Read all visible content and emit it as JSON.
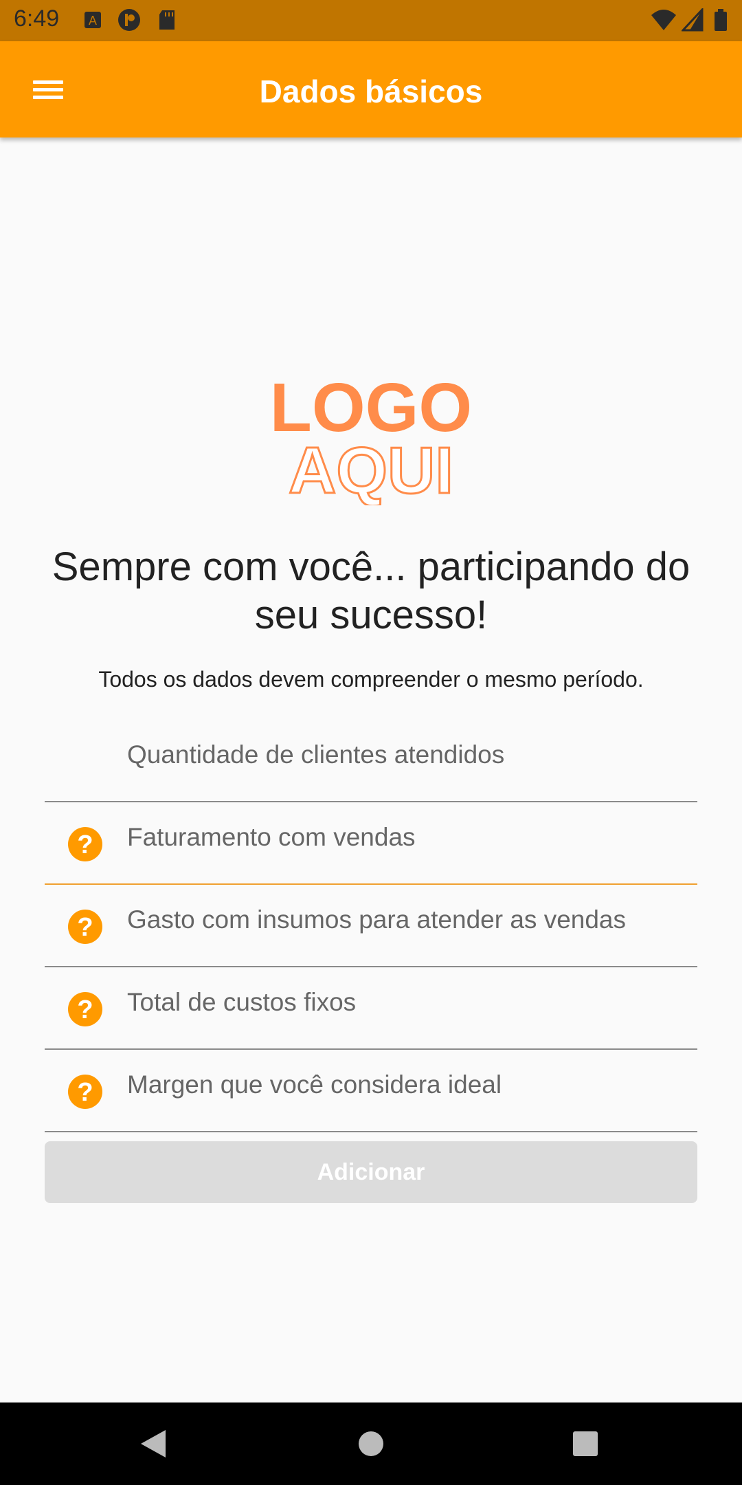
{
  "status_bar": {
    "time": "6:49",
    "icons": [
      "notification-a-icon",
      "notification-p-icon",
      "sd-card-icon",
      "wifi-icon",
      "signal-icon",
      "battery-icon"
    ]
  },
  "app_bar": {
    "title": "Dados básicos",
    "menu_icon": "hamburger-menu-icon"
  },
  "logo": {
    "line1": "LOGO",
    "line2": "AQUI",
    "color": "#ff8c4a"
  },
  "tagline": "Sempre com você... participando do seu sucesso!",
  "subtitle": "Todos os dados devem compreender o mesmo período.",
  "form": {
    "fields": [
      {
        "label": "Quantidade de clientes atendidos",
        "has_help": false
      },
      {
        "label": "Faturamento com vendas",
        "has_help": true,
        "focused": true
      },
      {
        "label": "Gasto com insumos para atender as  vendas",
        "has_help": true
      },
      {
        "label": "Total de custos fixos",
        "has_help": true
      },
      {
        "label": "Margen que você considera ideal",
        "has_help": true
      }
    ],
    "help_glyph": "?",
    "submit_label": "Adicionar"
  },
  "colors": {
    "primary": "#ff9a00",
    "status_bar": "#c07500",
    "focus_underline": "#f0a030",
    "disabled_button": "#dcdcdc"
  },
  "nav_bar": {
    "buttons": [
      "back-icon",
      "home-icon",
      "recents-icon"
    ]
  }
}
